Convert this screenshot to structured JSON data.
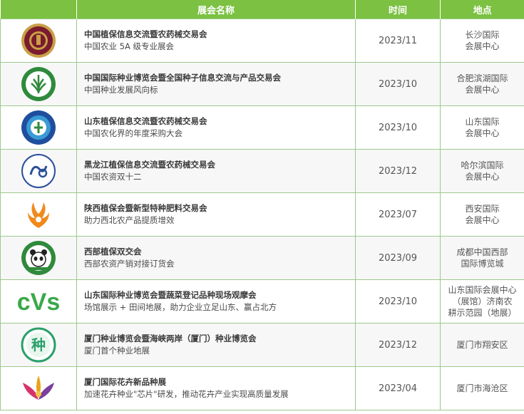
{
  "header": {
    "col_name": "展会名称",
    "col_time": "时间",
    "col_location": "地点"
  },
  "rows": [
    {
      "title": "中国植保信息交流暨农药械交易会",
      "subtitle": "中国农业 5A 级专业展会",
      "time": "2023/11",
      "location": [
        "长沙国际",
        "会展中心"
      ],
      "logo": "red-circle-emblem-icon"
    },
    {
      "title": "中国国际种业博览会暨全国种子信息交流与产品交易会",
      "subtitle": "中国种业发展风向标",
      "time": "2023/10",
      "location": [
        "合肥滨湖国际",
        "会展中心"
      ],
      "logo": "green-wheat-emblem-icon"
    },
    {
      "title": "山东植保信息交流暨农药械交易会",
      "subtitle": "中国农化界的年度采购大会",
      "time": "2023/10",
      "location": [
        "山东国际",
        "会展中心"
      ],
      "logo": "blue-circle-emblem-icon"
    },
    {
      "title": "黑龙江植保信息交流暨农药械交易会",
      "subtitle": "中国农资双十二",
      "time": "2023/12",
      "location": [
        "哈尔滨国际",
        "会展中心"
      ],
      "logo": "blue-swirl-emblem-icon"
    },
    {
      "title": "陕西植保会暨新型特种肥料交易会",
      "subtitle": "助力西北农产品提质增效",
      "time": "2023/07",
      "location": [
        "西安国际",
        "会展中心"
      ],
      "logo": "orange-phoenix-emblem-icon"
    },
    {
      "title": "西部植保双交会",
      "subtitle": "西部农资产销对接订货会",
      "time": "2023/09",
      "location": [
        "成都中国西部",
        "国际博览城"
      ],
      "logo": "green-panda-emblem-icon"
    },
    {
      "title": "山东国际种业博览会暨蔬菜登记品种现场观摩会",
      "subtitle": "场馆展示 + 田间地展，助力企业立足山东、赢占北方",
      "time": "2023/10",
      "location": [
        "山东国际会展中心",
        "（展馆）济南农",
        "耕示范园（地展）"
      ],
      "logo": "cvs-logo-icon"
    },
    {
      "title": "厦门种业博览会暨海峡两岸（厦门）种业博览会",
      "subtitle": "厦门首个种业地展",
      "time": "2023/12",
      "location": [
        "厦门市翔安区"
      ],
      "logo": "green-seed-emblem-icon",
      "logo_text": "种"
    },
    {
      "title": "厦门国际花卉新品种展",
      "subtitle": "加速花卉种业\"芯片\"研发，推动花卉产业实现高质量发展",
      "time": "2023/04",
      "location": [
        "厦门市海沧区"
      ],
      "logo": "flower-emblem-icon"
    }
  ],
  "logo_texts": {
    "cvs": "cVs",
    "seed": "种"
  },
  "colors": {
    "header_bg": "#7cc142",
    "border": "#9cc98c"
  }
}
